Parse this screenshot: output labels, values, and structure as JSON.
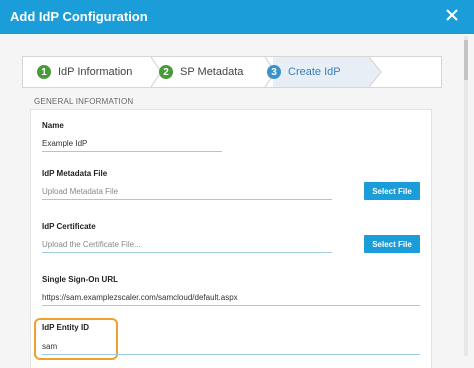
{
  "dialog": {
    "title": "Add IdP Configuration",
    "close_icon": "close-icon"
  },
  "wizard": {
    "steps": [
      {
        "number": "1",
        "label": "IdP Information",
        "status": "complete"
      },
      {
        "number": "2",
        "label": "SP Metadata",
        "status": "complete"
      },
      {
        "number": "3",
        "label": "Create IdP",
        "status": "active"
      }
    ]
  },
  "section": {
    "label": "GENERAL INFORMATION"
  },
  "fields": {
    "name": {
      "label": "Name",
      "value": "Example IdP"
    },
    "metadata_file": {
      "label": "IdP Metadata File",
      "placeholder": "Upload Metadata File",
      "button": "Select File"
    },
    "certificate": {
      "label": "IdP Certificate",
      "placeholder": "Upload the Certificate File...",
      "button": "Select File"
    },
    "sso_url": {
      "label": "Single Sign-On URL",
      "value": "https://sam.examplezscaler.com/samcloud/default.aspx"
    },
    "entity_id": {
      "label": "IdP Entity ID",
      "value": "sam"
    }
  },
  "colors": {
    "accent": "#1b9dd9",
    "step_complete": "#4a9a3a",
    "step_active": "#3a92c6",
    "highlight": "#f0a030"
  }
}
